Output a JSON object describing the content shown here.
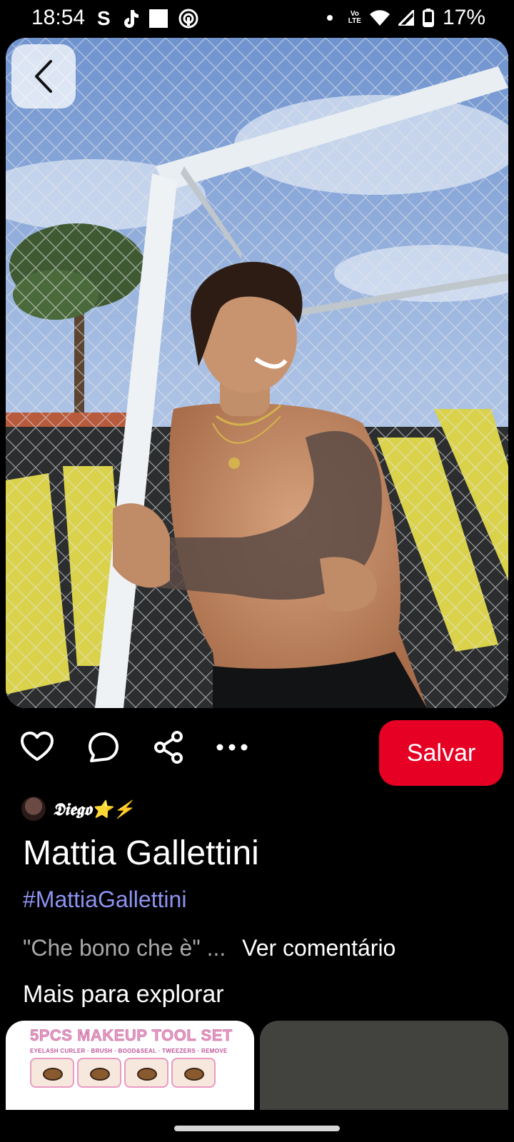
{
  "status_bar": {
    "time": "18:54",
    "left_icons": [
      "s-app-icon",
      "tiktok-icon",
      "square-notification-icon",
      "hotspot-icon"
    ],
    "lte_label_top": "Vo",
    "lte_label_bottom": "LTE",
    "battery": "17%"
  },
  "pin": {
    "image_desc_icon": "pin-photo",
    "author": {
      "name": "𝕯𝖎𝖊𝖌𝖔⭐⚡"
    },
    "title": "Mattia Gallettini",
    "hashtag": "#MattiaGallettini",
    "comment_preview": "\"Che bono che è\" ...",
    "view_comment_label": "Ver comentário"
  },
  "actions": {
    "like_icon": "heart-icon",
    "comment_icon": "comment-icon",
    "share_icon": "share-icon",
    "more_icon": "more-icon",
    "save_label": "Salvar",
    "save_color": "#e60023"
  },
  "explore": {
    "heading": "Mais para explorar",
    "cards": [
      {
        "heading": "5PCS MAKEUP TOOL SET",
        "subtitle": "EYELASH CURLER · BRUSH · BOOD&SEAL · TWEEZERS · REMOVE"
      },
      {}
    ]
  },
  "colors": {
    "background": "#000000",
    "accent_red": "#e60023",
    "hashtag": "#8d93f1",
    "muted_text": "#a9a9a9"
  }
}
